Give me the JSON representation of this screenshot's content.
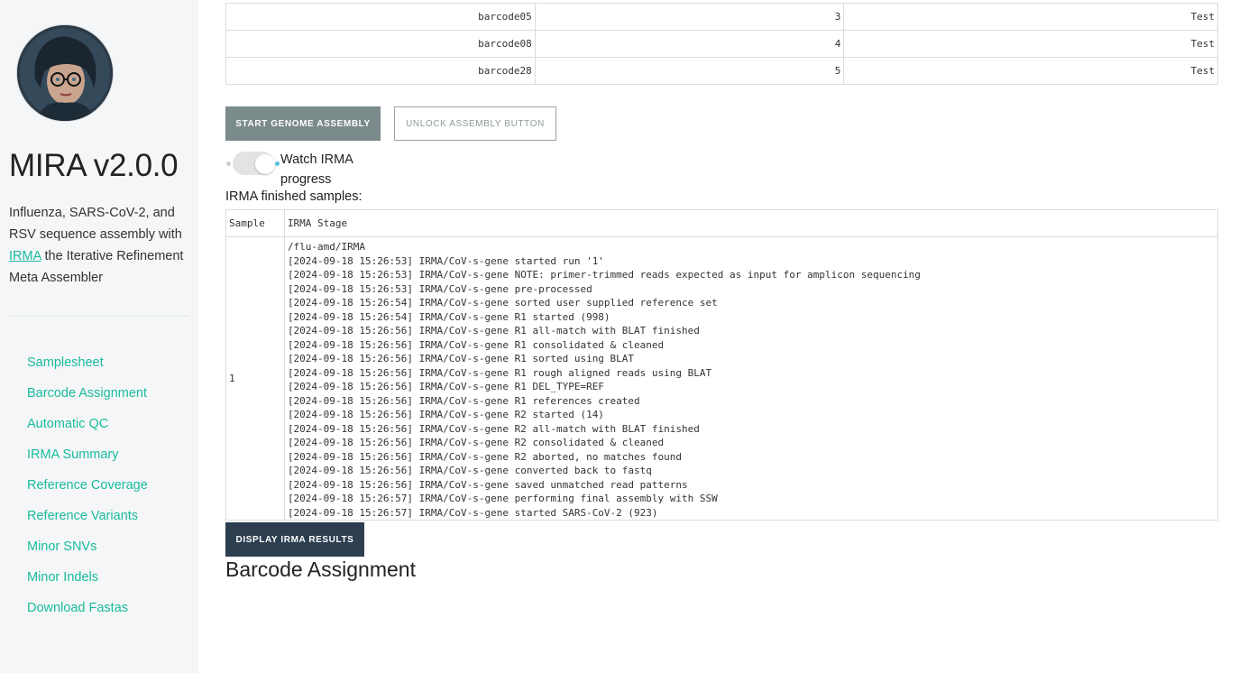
{
  "sidebar": {
    "title": "MIRA v2.0.0",
    "desc_before": "Influenza, SARS-CoV-2, and RSV sequence assembly with ",
    "desc_link": "IRMA",
    "desc_after": " the Iterative Refinement Meta Assembler",
    "nav": [
      {
        "label": "Samplesheet"
      },
      {
        "label": "Barcode Assignment"
      },
      {
        "label": "Automatic QC"
      },
      {
        "label": "IRMA Summary"
      },
      {
        "label": "Reference Coverage"
      },
      {
        "label": "Reference Variants"
      },
      {
        "label": "Minor SNVs"
      },
      {
        "label": "Minor Indels"
      },
      {
        "label": "Download Fastas"
      }
    ]
  },
  "top_table": {
    "rows": [
      [
        "barcode05",
        "3",
        "Test"
      ],
      [
        "barcode08",
        "4",
        "Test"
      ],
      [
        "barcode28",
        "5",
        "Test"
      ]
    ]
  },
  "buttons": {
    "start": "START GENOME ASSEMBLY",
    "unlock": "UNLOCK ASSEMBLY BUTTON",
    "display": "DISPLAY IRMA RESULTS"
  },
  "toggle": {
    "label": "Watch IRMA progress",
    "on": true
  },
  "irma": {
    "finished_label": "IRMA finished samples:",
    "headers": [
      "Sample",
      "IRMA Stage"
    ],
    "sample": "1",
    "log": [
      "/flu-amd/IRMA",
      "[2024-09-18 15:26:53] IRMA/CoV-s-gene started run '1'",
      "[2024-09-18 15:26:53] IRMA/CoV-s-gene NOTE: primer-trimmed reads expected as input for amplicon sequencing",
      "[2024-09-18 15:26:53] IRMA/CoV-s-gene pre-processed",
      "[2024-09-18 15:26:54] IRMA/CoV-s-gene sorted user supplied reference set",
      "[2024-09-18 15:26:54] IRMA/CoV-s-gene R1 started (998)",
      "[2024-09-18 15:26:56] IRMA/CoV-s-gene R1 all-match with BLAT finished",
      "[2024-09-18 15:26:56] IRMA/CoV-s-gene R1 consolidated & cleaned",
      "[2024-09-18 15:26:56] IRMA/CoV-s-gene R1 sorted using BLAT",
      "[2024-09-18 15:26:56] IRMA/CoV-s-gene R1 rough aligned reads using BLAT",
      "[2024-09-18 15:26:56] IRMA/CoV-s-gene R1 DEL_TYPE=REF",
      "[2024-09-18 15:26:56] IRMA/CoV-s-gene R1 references created",
      "[2024-09-18 15:26:56] IRMA/CoV-s-gene R2 started (14)",
      "[2024-09-18 15:26:56] IRMA/CoV-s-gene R2 all-match with BLAT finished",
      "[2024-09-18 15:26:56] IRMA/CoV-s-gene R2 consolidated & cleaned",
      "[2024-09-18 15:26:56] IRMA/CoV-s-gene R2 aborted, no matches found",
      "[2024-09-18 15:26:56] IRMA/CoV-s-gene converted back to fastq",
      "[2024-09-18 15:26:56] IRMA/CoV-s-gene saved unmatched read patterns",
      "[2024-09-18 15:26:57] IRMA/CoV-s-gene performing final assembly with SSW",
      "[2024-09-18 15:26:57] IRMA/CoV-s-gene started SARS-CoV-2 (923)"
    ]
  },
  "section": {
    "title": "Barcode Assignment"
  },
  "colors": {
    "link": "#18bc9c",
    "primary_dark": "#2c3e50",
    "secondary": "#7b8a8b",
    "sidebar_bg": "#f5f6f7"
  }
}
